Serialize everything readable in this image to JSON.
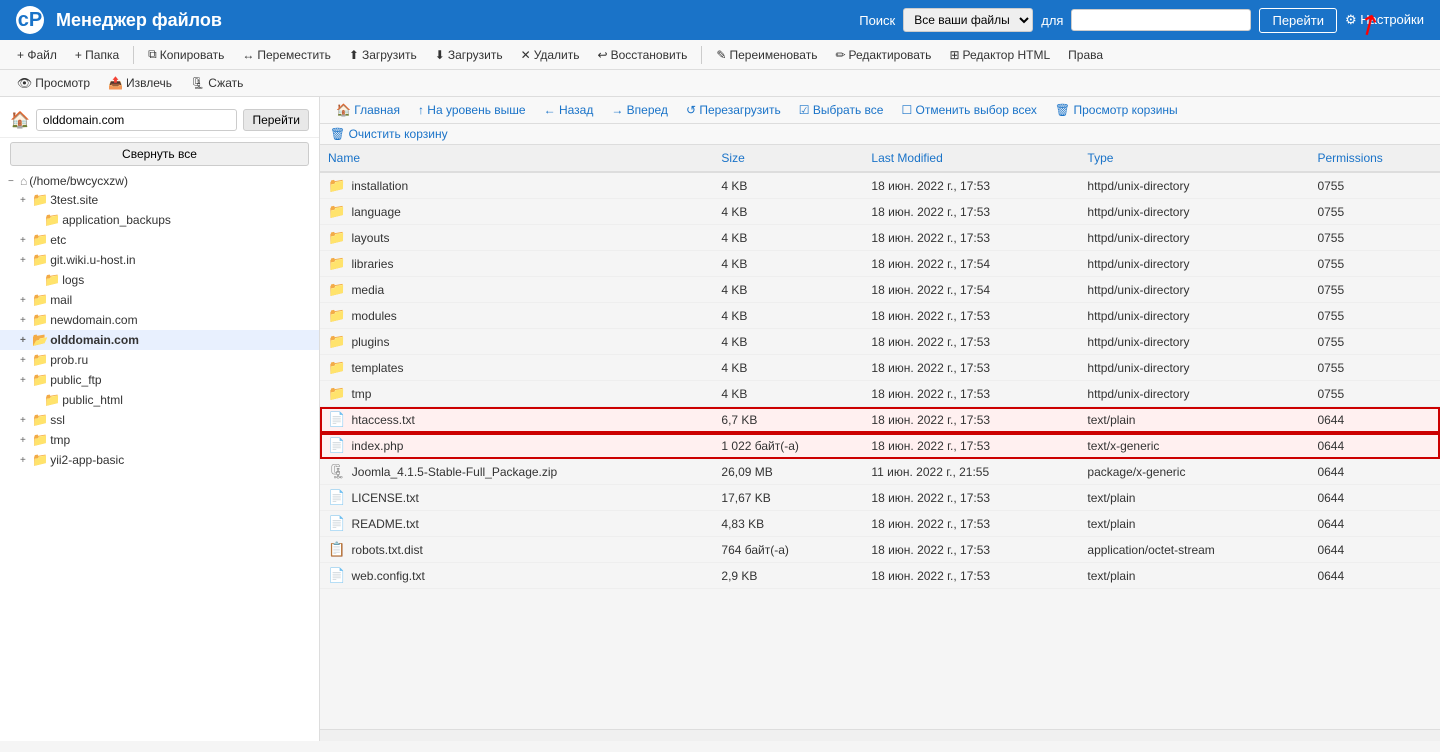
{
  "header": {
    "logo": "cP",
    "title": "Менеджер файлов",
    "search_label": "Поиск",
    "search_option": "Все ваши файлы",
    "search_for": "для",
    "search_placeholder": "",
    "go_btn": "Перейти",
    "settings_btn": "⚙ Настройки"
  },
  "toolbar": {
    "file_btn": "+ Файл",
    "folder_btn": "+ Папка",
    "copy_btn": "Копировать",
    "move_btn": "Переместить",
    "upload_btn": "Загрузить",
    "download_btn": "Загрузить",
    "delete_btn": "Удалить",
    "restore_btn": "Восстановить",
    "rename_btn": "Переименовать",
    "edit_btn": "Редактировать",
    "html_editor_btn": "Редактор HTML",
    "rights_btn": "Права",
    "view_btn": "Просмотр",
    "extract_btn": "Извлечь",
    "compress_btn": "Сжать"
  },
  "nav": {
    "home_btn": "🏠 Главная",
    "up_btn": "↑ На уровень выше",
    "back_btn": "← Назад",
    "forward_btn": "→ Вперед",
    "reload_btn": "↺ Перезагрузить",
    "select_all_btn": "☑ Выбрать все",
    "deselect_btn": "☐ Отменить выбор всех",
    "trash_btn": "🗑 Просмотр корзины"
  },
  "action": {
    "clear_trash_btn": "🗑 Очистить корзину"
  },
  "path": {
    "value": "olddomain.com",
    "go_btn": "Перейти"
  },
  "sidebar": {
    "collapse_btn": "Свернуть все",
    "tree": [
      {
        "label": "⌂ (/home/bwcycxzw)",
        "level": 0,
        "icon": "root",
        "expanded": true
      },
      {
        "label": "3test.site",
        "level": 1,
        "icon": "folder",
        "expanded": true
      },
      {
        "label": "application_backups",
        "level": 2,
        "icon": "folder",
        "expanded": false
      },
      {
        "label": "etc",
        "level": 1,
        "icon": "folder",
        "expanded": true
      },
      {
        "label": "git.wiki.u-host.in",
        "level": 1,
        "icon": "folder",
        "expanded": true
      },
      {
        "label": "logs",
        "level": 2,
        "icon": "folder",
        "expanded": false
      },
      {
        "label": "mail",
        "level": 1,
        "icon": "folder",
        "expanded": true
      },
      {
        "label": "newdomain.com",
        "level": 1,
        "icon": "folder",
        "expanded": true
      },
      {
        "label": "olddomain.com",
        "level": 1,
        "icon": "folder",
        "expanded": true,
        "selected": true
      },
      {
        "label": "prob.ru",
        "level": 1,
        "icon": "folder",
        "expanded": true
      },
      {
        "label": "public_ftp",
        "level": 1,
        "icon": "folder",
        "expanded": true
      },
      {
        "label": "public_html",
        "level": 2,
        "icon": "folder",
        "expanded": false
      },
      {
        "label": "ssl",
        "level": 1,
        "icon": "folder",
        "expanded": true
      },
      {
        "label": "tmp",
        "level": 1,
        "icon": "folder",
        "expanded": true
      },
      {
        "label": "yii2-app-basic",
        "level": 1,
        "icon": "folder",
        "expanded": false
      }
    ]
  },
  "table": {
    "columns": [
      "Name",
      "Size",
      "Last Modified",
      "Type",
      "Permissions"
    ],
    "rows": [
      {
        "name": "installation",
        "type_icon": "folder",
        "size": "4 KB",
        "modified": "18 июн. 2022 г., 17:53",
        "type": "httpd/unix-directory",
        "perms": "0755",
        "selected": false
      },
      {
        "name": "language",
        "type_icon": "folder",
        "size": "4 KB",
        "modified": "18 июн. 2022 г., 17:53",
        "type": "httpd/unix-directory",
        "perms": "0755",
        "selected": false
      },
      {
        "name": "layouts",
        "type_icon": "folder",
        "size": "4 KB",
        "modified": "18 июн. 2022 г., 17:53",
        "type": "httpd/unix-directory",
        "perms": "0755",
        "selected": false
      },
      {
        "name": "libraries",
        "type_icon": "folder",
        "size": "4 KB",
        "modified": "18 июн. 2022 г., 17:54",
        "type": "httpd/unix-directory",
        "perms": "0755",
        "selected": false
      },
      {
        "name": "media",
        "type_icon": "folder",
        "size": "4 KB",
        "modified": "18 июн. 2022 г., 17:54",
        "type": "httpd/unix-directory",
        "perms": "0755",
        "selected": false
      },
      {
        "name": "modules",
        "type_icon": "folder",
        "size": "4 KB",
        "modified": "18 июн. 2022 г., 17:53",
        "type": "httpd/unix-directory",
        "perms": "0755",
        "selected": false
      },
      {
        "name": "plugins",
        "type_icon": "folder",
        "size": "4 KB",
        "modified": "18 июн. 2022 г., 17:53",
        "type": "httpd/unix-directory",
        "perms": "0755",
        "selected": false
      },
      {
        "name": "templates",
        "type_icon": "folder",
        "size": "4 KB",
        "modified": "18 июн. 2022 г., 17:53",
        "type": "httpd/unix-directory",
        "perms": "0755",
        "selected": false
      },
      {
        "name": "tmp",
        "type_icon": "folder",
        "size": "4 KB",
        "modified": "18 июн. 2022 г., 17:53",
        "type": "httpd/unix-directory",
        "perms": "0755",
        "selected": false
      },
      {
        "name": "htaccess.txt",
        "type_icon": "text",
        "size": "6,7 KB",
        "modified": "18 июн. 2022 г., 17:53",
        "type": "text/plain",
        "perms": "0644",
        "selected": true
      },
      {
        "name": "index.php",
        "type_icon": "text",
        "size": "1 022 байт(-а)",
        "modified": "18 июн. 2022 г., 17:53",
        "type": "text/x-generic",
        "perms": "0644",
        "selected": true
      },
      {
        "name": "Joomla_4.1.5-Stable-Full_Package.zip",
        "type_icon": "zip",
        "size": "26,09 MB",
        "modified": "11 июн. 2022 г., 21:55",
        "type": "package/x-generic",
        "perms": "0644",
        "selected": false
      },
      {
        "name": "LICENSE.txt",
        "type_icon": "text",
        "size": "17,67 KB",
        "modified": "18 июн. 2022 г., 17:53",
        "type": "text/plain",
        "perms": "0644",
        "selected": false
      },
      {
        "name": "README.txt",
        "type_icon": "text",
        "size": "4,83 KB",
        "modified": "18 июн. 2022 г., 17:53",
        "type": "text/plain",
        "perms": "0644",
        "selected": false
      },
      {
        "name": "robots.txt.dist",
        "type_icon": "file",
        "size": "764 байт(-а)",
        "modified": "18 июн. 2022 г., 17:53",
        "type": "application/octet-stream",
        "perms": "0644",
        "selected": false
      },
      {
        "name": "web.config.txt",
        "type_icon": "text",
        "size": "2,9 KB",
        "modified": "18 июн. 2022 г., 17:53",
        "type": "text/plain",
        "perms": "0644",
        "selected": false
      }
    ]
  }
}
